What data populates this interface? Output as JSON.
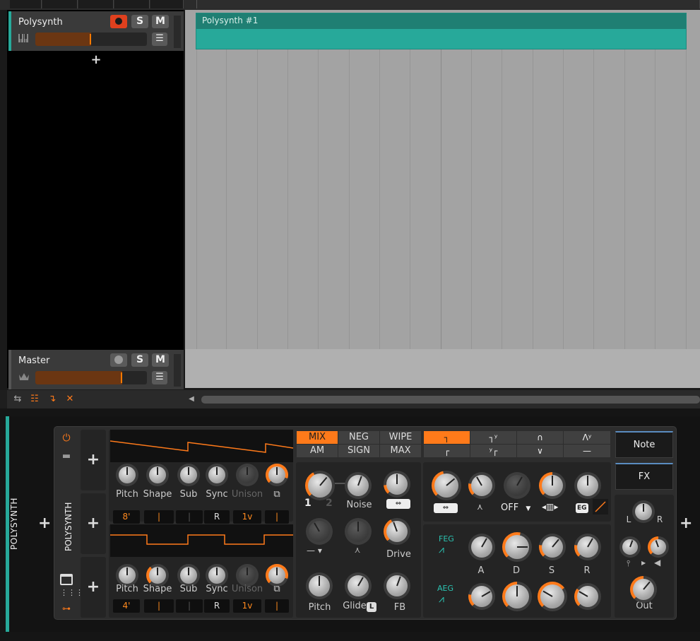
{
  "arranger": {
    "tracks": [
      {
        "name": "Polysynth",
        "solo_label": "S",
        "mute_label": "M",
        "volume_fraction": 0.5
      },
      {
        "name": "Master",
        "solo_label": "S",
        "mute_label": "M",
        "volume_fraction": 0.78
      }
    ],
    "add_track_label": "+",
    "clip_title": "Polysynth #1"
  },
  "device": {
    "track_label": "POLYSYNTH",
    "device_name": "POLYSYNTH",
    "add_label": "+",
    "osc1": {
      "knobs": [
        "Pitch",
        "Shape",
        "Sub",
        "Sync",
        "Unison",
        "⧉"
      ],
      "values": [
        "8'",
        "|",
        "|",
        "R",
        "1v",
        "|"
      ]
    },
    "osc2": {
      "knobs": [
        "Pitch",
        "Shape",
        "Sub",
        "Sync",
        "Unison",
        "⧉"
      ],
      "values": [
        "4'",
        "|",
        "|",
        "R",
        "1v",
        "|"
      ]
    },
    "mix_modes": {
      "row1": [
        "MIX",
        "NEG",
        "WIPE"
      ],
      "row2": [
        "AM",
        "SIGN",
        "MAX"
      ],
      "active": "MIX"
    },
    "mixer": {
      "osc_nums": [
        "1",
        "2"
      ],
      "noise_label": "Noise",
      "drive_label": "Drive",
      "pitch_label": "Pitch",
      "glide_label": "Glide",
      "glide_badge": "L",
      "fb_label": "FB",
      "dash_label": "—"
    },
    "filter": {
      "type_glyphs_row1": [
        "┐",
        "┐ʸ",
        "∩",
        "Λʸ"
      ],
      "type_glyphs_row2": [
        "┌",
        "ʸ┌",
        "∨",
        "—"
      ],
      "off_label": "OFF",
      "eg_label": "EG"
    },
    "env": {
      "feg_label": "FEG",
      "aeg_label": "AEG",
      "adsr": [
        "A",
        "D",
        "S",
        "R"
      ]
    },
    "side": {
      "note_label": "Note",
      "fx_label": "FX",
      "l_label": "L",
      "r_label": "R",
      "out_label": "Out"
    }
  },
  "colors": {
    "accent": "#ff7a1a",
    "teal": "#27a99a",
    "record": "#e0401e"
  }
}
